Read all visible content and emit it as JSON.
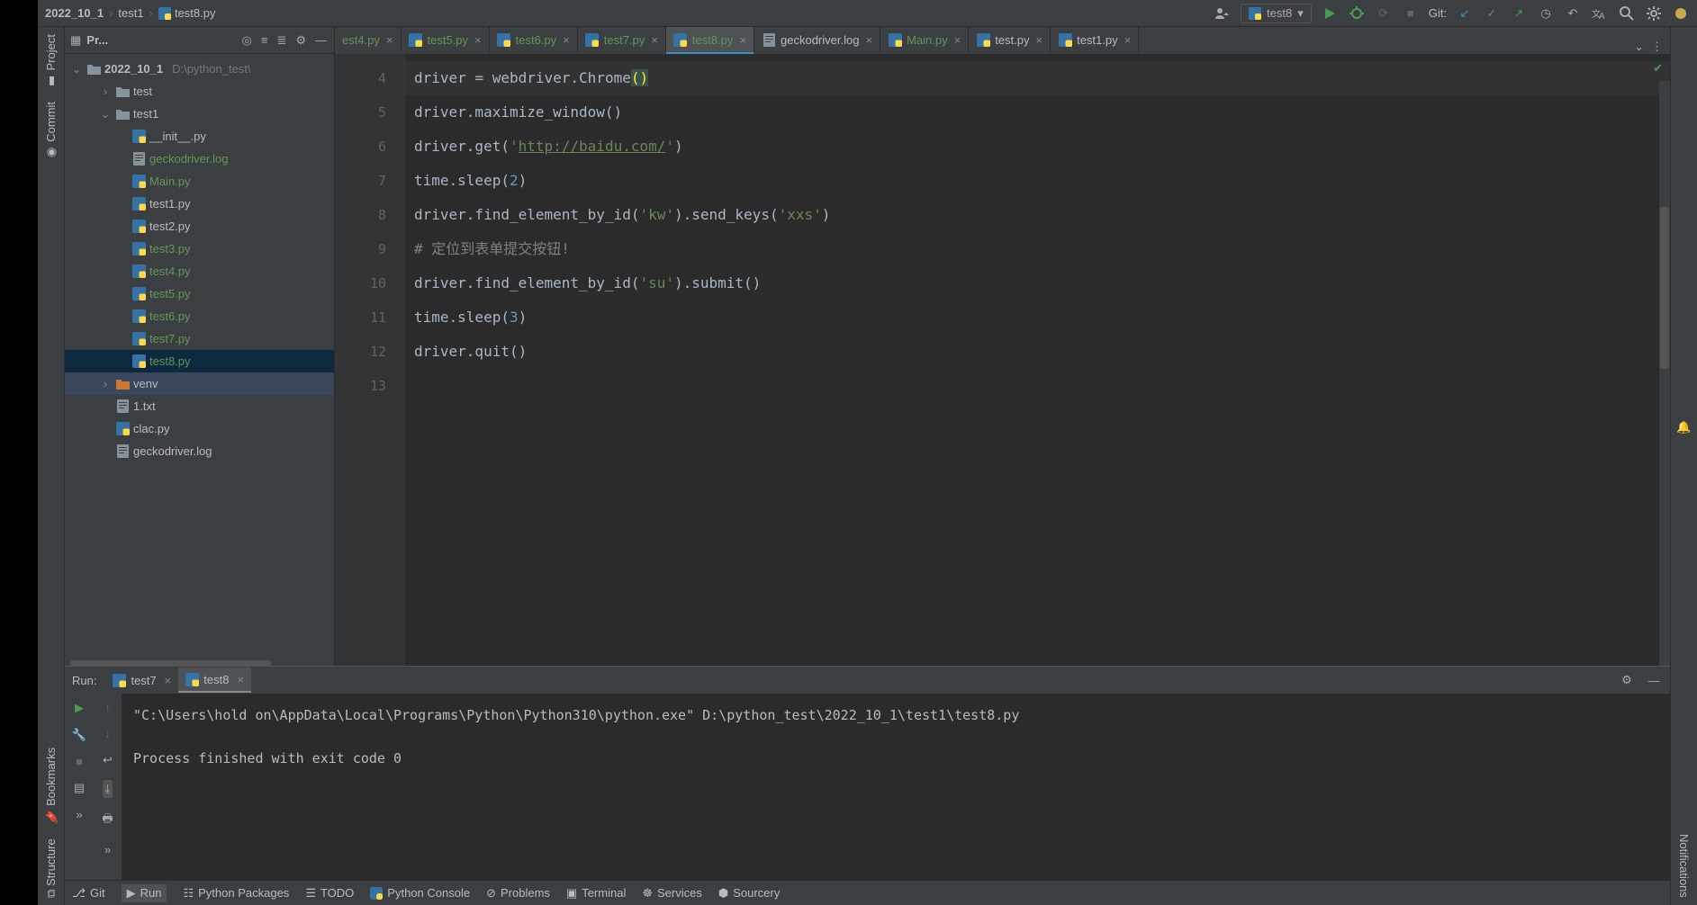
{
  "breadcrumb": {
    "project": "2022_10_1",
    "folder": "test1",
    "file": "test8.py"
  },
  "run_config": {
    "name": "test8"
  },
  "toolbar": {
    "git": "Git:"
  },
  "project": {
    "title": "Pr...",
    "root": {
      "name": "2022_10_1",
      "path": "D:\\python_test\\"
    },
    "tree": [
      {
        "indent": 1,
        "arrow": "›",
        "type": "folder",
        "name": "test"
      },
      {
        "indent": 1,
        "arrow": "⌄",
        "type": "folder",
        "name": "test1"
      },
      {
        "indent": 2,
        "type": "py",
        "name": "__init__.py"
      },
      {
        "indent": 2,
        "type": "txt",
        "name": "geckodriver.log",
        "green": true
      },
      {
        "indent": 2,
        "type": "py",
        "name": "Main.py",
        "green": true
      },
      {
        "indent": 2,
        "type": "py",
        "name": "test1.py"
      },
      {
        "indent": 2,
        "type": "py",
        "name": "test2.py"
      },
      {
        "indent": 2,
        "type": "py",
        "name": "test3.py",
        "green": true
      },
      {
        "indent": 2,
        "type": "py",
        "name": "test4.py",
        "green": true
      },
      {
        "indent": 2,
        "type": "py",
        "name": "test5.py",
        "green": true
      },
      {
        "indent": 2,
        "type": "py",
        "name": "test6.py",
        "green": true
      },
      {
        "indent": 2,
        "type": "py",
        "name": "test7.py",
        "green": true
      },
      {
        "indent": 2,
        "type": "py",
        "name": "test8.py",
        "green": true,
        "selected": true
      },
      {
        "indent": 1,
        "arrow": "›",
        "type": "folder-orange",
        "name": "venv",
        "sel": true
      },
      {
        "indent": 1,
        "type": "txt",
        "name": "1.txt"
      },
      {
        "indent": 1,
        "type": "py",
        "name": "clac.py"
      },
      {
        "indent": 1,
        "type": "txt",
        "name": "geckodriver.log"
      }
    ]
  },
  "tabs": [
    {
      "name": "est4.py",
      "green": true,
      "partial": true
    },
    {
      "name": "test5.py",
      "green": true
    },
    {
      "name": "test6.py",
      "green": true
    },
    {
      "name": "test7.py",
      "green": true
    },
    {
      "name": "test8.py",
      "green": true,
      "active": true
    },
    {
      "name": "geckodriver.log",
      "icon": "txt"
    },
    {
      "name": "Main.py",
      "green": true
    },
    {
      "name": "test.py"
    },
    {
      "name": "test1.py"
    }
  ],
  "code": {
    "start": 4,
    "lines": [
      {
        "n": 4,
        "current": true,
        "html": "driver <span class='tk-op'>=</span> webdriver.Chrome<span class='brace-hl'>(</span><span class='brace-hl'>)</span>"
      },
      {
        "n": 5,
        "html": "driver.maximize_window()"
      },
      {
        "n": 6,
        "html": "driver.get(<span class='tk-str'>'<span class='tk-url'>http://baidu.com/</span>'</span>)"
      },
      {
        "n": 7,
        "html": "time.sleep(<span class='tk-num'>2</span>)"
      },
      {
        "n": 8,
        "html": "driver.find_element_by_id(<span class='tk-str'>'kw'</span>).send_keys(<span class='tk-str'>'xxs'</span>)"
      },
      {
        "n": 9,
        "html": "<span class='tk-cmt'># 定位到表单提交按钮!</span>"
      },
      {
        "n": 10,
        "html": "driver.find_element_by_id(<span class='tk-str'>'su'</span>).submit()"
      },
      {
        "n": 11,
        "html": "time.sleep(<span class='tk-num'>3</span>)"
      },
      {
        "n": 12,
        "html": "driver.quit()"
      },
      {
        "n": 13,
        "html": ""
      }
    ]
  },
  "run": {
    "label": "Run:",
    "tabs": [
      {
        "name": "test7"
      },
      {
        "name": "test8",
        "active": true
      }
    ],
    "output_line1": "\"C:\\Users\\hold on\\AppData\\Local\\Programs\\Python\\Python310\\python.exe\" D:\\python_test\\2022_10_1\\test1\\test8.py",
    "output_line2": "Process finished with exit code 0"
  },
  "bottom": {
    "git": "Git",
    "run": "Run",
    "packages": "Python Packages",
    "todo": "TODO",
    "console": "Python Console",
    "problems": "Problems",
    "terminal": "Terminal",
    "services": "Services",
    "sourcery": "Sourcery"
  },
  "side": {
    "project": "Project",
    "commit": "Commit",
    "bookmarks": "Bookmarks",
    "structure": "Structure",
    "notifications": "Notifications"
  }
}
